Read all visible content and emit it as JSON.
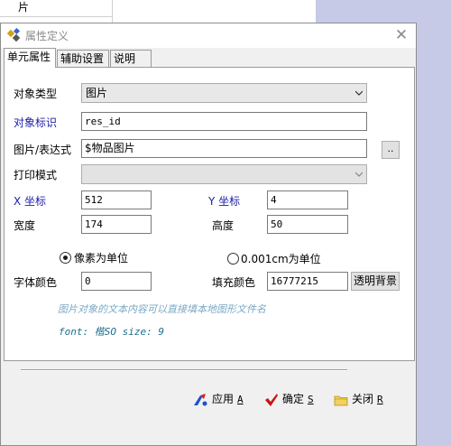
{
  "background": {
    "cell_text": "片"
  },
  "dialog": {
    "title": "属性定义",
    "tabs": [
      {
        "label": "单元属性",
        "active": true
      },
      {
        "label": "辅助设置",
        "active": false
      },
      {
        "label": "说明",
        "active": false
      }
    ],
    "fields": {
      "object_type": {
        "label": "对象类型",
        "value": "图片"
      },
      "object_id": {
        "label": "对象标识",
        "value": "res_id"
      },
      "expression": {
        "label": "图片/表达式",
        "value": "$物品图片",
        "browse_label": ".."
      },
      "print_mode": {
        "label": "打印模式",
        "value": ""
      },
      "x": {
        "label": "X 坐标",
        "value": "512"
      },
      "y": {
        "label": "Y 坐标",
        "value": "4"
      },
      "width": {
        "label": "宽度",
        "value": "174"
      },
      "height": {
        "label": "高度",
        "value": "50"
      },
      "font_color": {
        "label": "字体颜色",
        "value": "0"
      },
      "fill_color": {
        "label": "填充颜色",
        "value": "16777215"
      }
    },
    "units": {
      "pixel_label": "像素为单位",
      "mm_label": "0.001cm为单位",
      "selected": "pixel"
    },
    "transparent_bg_label": "透明背景",
    "hint": "图片对象的文本内容可以直接填本地图形文件名",
    "font_info": "font:  楷SO  size:  9",
    "buttons": {
      "apply": {
        "label": "应用",
        "key": "A"
      },
      "ok": {
        "label": "确定",
        "key": "S"
      },
      "close": {
        "label": "关闭",
        "key": "R"
      }
    },
    "colors": {
      "blue_label": "#1c1ca8",
      "hint": "#7aa8c4",
      "font_info": "#1f6f8f",
      "desktop": "#c6cae6"
    }
  }
}
